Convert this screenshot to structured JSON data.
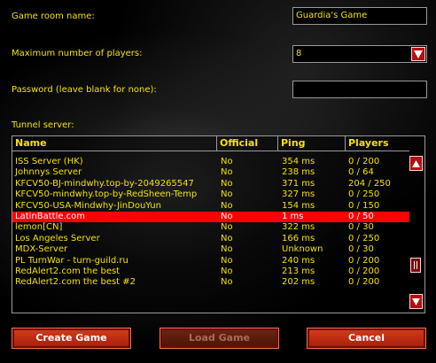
{
  "form": {
    "room_name_label": "Game room name:",
    "room_name_value": "Guardia's Game",
    "max_players_label": "Maximum number of players:",
    "max_players_value": "8",
    "password_label": "Password (leave blank for none):",
    "password_value": ""
  },
  "tunnel": {
    "label": "Tunnel server:",
    "columns": [
      "Name",
      "Official",
      "Ping",
      "Players"
    ],
    "rows": [
      {
        "name": "ISS Server (HK)",
        "official": "No",
        "ping": "354 ms",
        "players": "0 / 200"
      },
      {
        "name": "Johnnys Server",
        "official": "No",
        "ping": "238 ms",
        "players": "0 / 64"
      },
      {
        "name": "KFCV50-BJ-mindwhy.top-by-2049265547",
        "official": "No",
        "ping": "371 ms",
        "players": "204 / 250"
      },
      {
        "name": "KFCV50-mindwhy.top-by-RedSheen-Temp",
        "official": "No",
        "ping": "327 ms",
        "players": "0 / 250"
      },
      {
        "name": "KFCV50-USA-Mindwhy-JinDouYun",
        "official": "No",
        "ping": "154 ms",
        "players": "0 / 150"
      },
      {
        "name": "LatinBattle.com",
        "official": "No",
        "ping": "1 ms",
        "players": "0 / 50",
        "selected": true
      },
      {
        "name": "lemon[CN]",
        "official": "No",
        "ping": "322 ms",
        "players": "0 / 30"
      },
      {
        "name": "Los Angeles Server",
        "official": "No",
        "ping": "166 ms",
        "players": "0 / 250"
      },
      {
        "name": "MDX-Server",
        "official": "No",
        "ping": "Unknown",
        "players": "0 / 30"
      },
      {
        "name": "PL TurnWar - turn-guild.ru",
        "official": "No",
        "ping": "240 ms",
        "players": "0 / 200"
      },
      {
        "name": "RedAlert2.com the best",
        "official": "No",
        "ping": "213 ms",
        "players": "0 / 200"
      },
      {
        "name": "RedAlert2.com the best #2",
        "official": "No",
        "ping": "202 ms",
        "players": "0 / 200"
      }
    ]
  },
  "buttons": {
    "create": "Create Game",
    "load": "Load Game",
    "cancel": "Cancel"
  },
  "icons": {
    "dropdown": "triangle-down-icon",
    "scroll_up": "triangle-up-icon",
    "scroll_down": "triangle-down-icon"
  },
  "colors": {
    "text": "#f3e200",
    "selection": "#ff0000",
    "button": "#c02c14"
  }
}
